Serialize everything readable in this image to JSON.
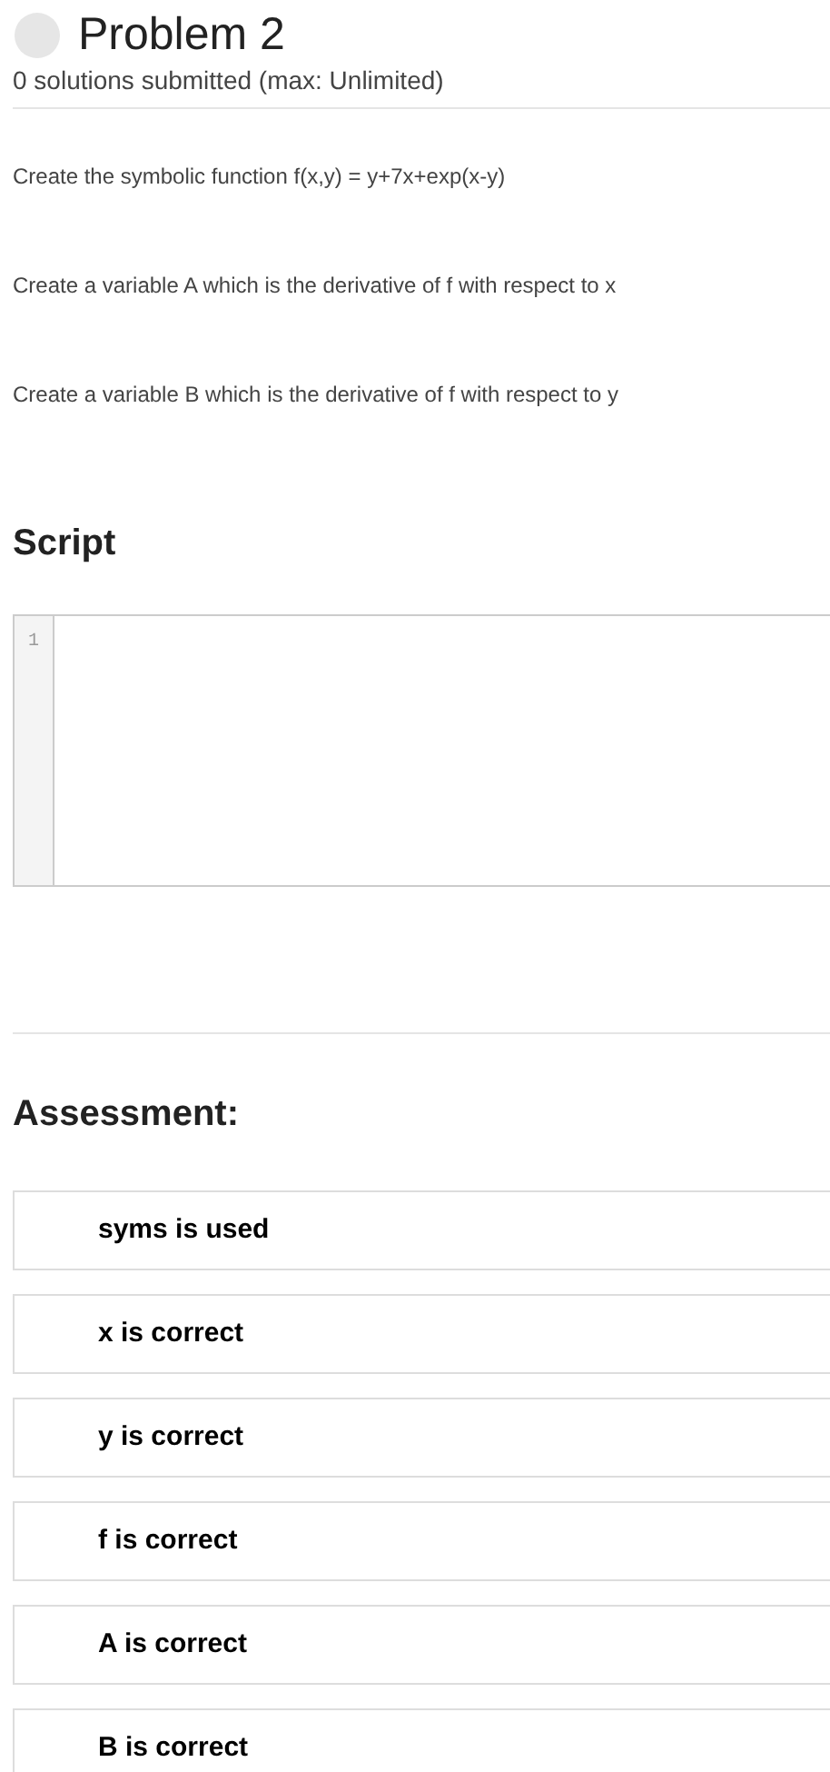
{
  "problem": {
    "title": "Problem 2",
    "subtitle": "0 solutions submitted (max: Unlimited)"
  },
  "instructions": [
    "Create the symbolic function f(x,y) = y+7x+exp(x-y)",
    "Create a variable A which is the derivative of f with respect to x",
    "Create a variable B which is the derivative of f with respect to y"
  ],
  "script": {
    "heading": "Script",
    "line_numbers": [
      "1"
    ]
  },
  "assessment": {
    "heading": "Assessment:",
    "tests": [
      "syms is used",
      "x is correct",
      "y is correct",
      "f is correct",
      "A is correct",
      "B is correct"
    ]
  }
}
